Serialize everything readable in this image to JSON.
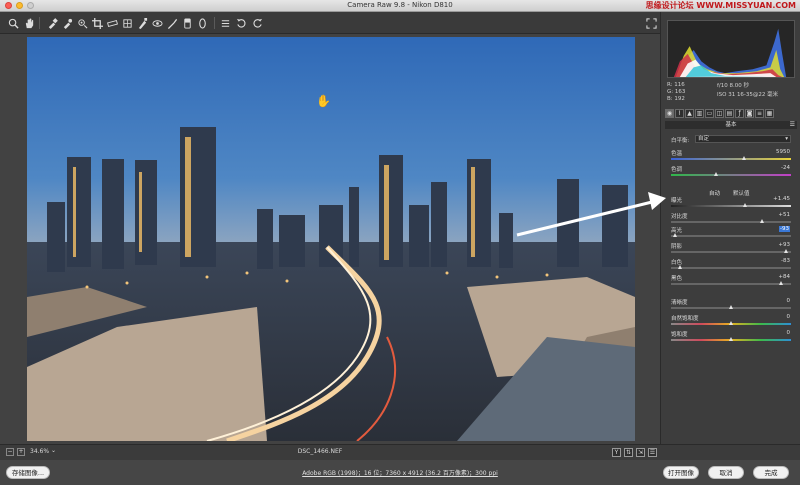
{
  "window": {
    "title": "Camera Raw 9.8 -  Nikon D810",
    "watermark": "思缘设计论坛 WWW.MISSYUAN.COM"
  },
  "toolbar": {
    "tools": [
      "zoom-icon",
      "hand-icon",
      "white-balance-icon",
      "color-sampler-icon",
      "target-adjust-icon",
      "crop-icon",
      "straighten-icon",
      "transform-icon",
      "spot-removal-icon",
      "red-eye-icon",
      "adjustment-brush-icon",
      "graduated-filter-icon",
      "radial-filter-icon",
      "preferences-icon",
      "rotate-left-icon",
      "rotate-right-icon"
    ]
  },
  "histogram": {
    "rgb_labels": [
      "R:",
      "G:",
      "B:"
    ],
    "rgb_values": [
      "116",
      "163",
      "192"
    ],
    "camera_info": [
      "f/10    8.00 秒",
      "ISO 31    16-35@22 毫米"
    ]
  },
  "panel": {
    "section_title": "基本",
    "white_balance_label": "白平衡:",
    "white_balance_value": "自定",
    "auto_label": "自动",
    "default_label": "默认值",
    "sliders": [
      {
        "label": "色温",
        "value": "5950",
        "position": 0.61,
        "gradient": "linear-gradient(90deg,#3a62d8,#e8d23a)"
      },
      {
        "label": "色调",
        "value": "-24",
        "position": 0.38,
        "gradient": "linear-gradient(90deg,#2fb84a,#c23fc8)"
      },
      {
        "label": "曝光",
        "value": "+1.45",
        "position": 0.62,
        "gradient": "linear-gradient(90deg,#222,#ddd)"
      },
      {
        "label": "对比度",
        "value": "+51",
        "position": 0.76,
        "gradient": "#666"
      },
      {
        "label": "高光",
        "value": "-93",
        "position": 0.04,
        "gradient": "#666",
        "highlight": true
      },
      {
        "label": "阴影",
        "value": "+93",
        "position": 0.96,
        "gradient": "#666"
      },
      {
        "label": "白色",
        "value": "-83",
        "position": 0.08,
        "gradient": "#666"
      },
      {
        "label": "黑色",
        "value": "+84",
        "position": 0.92,
        "gradient": "#666"
      },
      {
        "label": "清晰度",
        "value": "0",
        "position": 0.5,
        "gradient": "#666"
      },
      {
        "label": "自然饱和度",
        "value": "0",
        "position": 0.5,
        "gradient": "linear-gradient(90deg,#888,#d04a5c,#e6b020,#3cba4b,#2d8fd6)"
      },
      {
        "label": "饱和度",
        "value": "0",
        "position": 0.5,
        "gradient": "linear-gradient(90deg,#888,#d04a5c,#e6b020,#3cba4b,#2d8fd6)"
      }
    ]
  },
  "status": {
    "zoom_level": "34.6%",
    "filename": "DSC_1466.NEF",
    "workflow": "Adobe RGB (1998)；16 位；7360 x 4912 (36.2 百万像素)；300 ppi"
  },
  "footer": {
    "save_label": "存储图像...",
    "open_label": "打开图像",
    "cancel_label": "取消",
    "done_label": "完成"
  },
  "colors": {
    "accent": "#3a78d6",
    "annotation_arrow": "#ffffff"
  }
}
